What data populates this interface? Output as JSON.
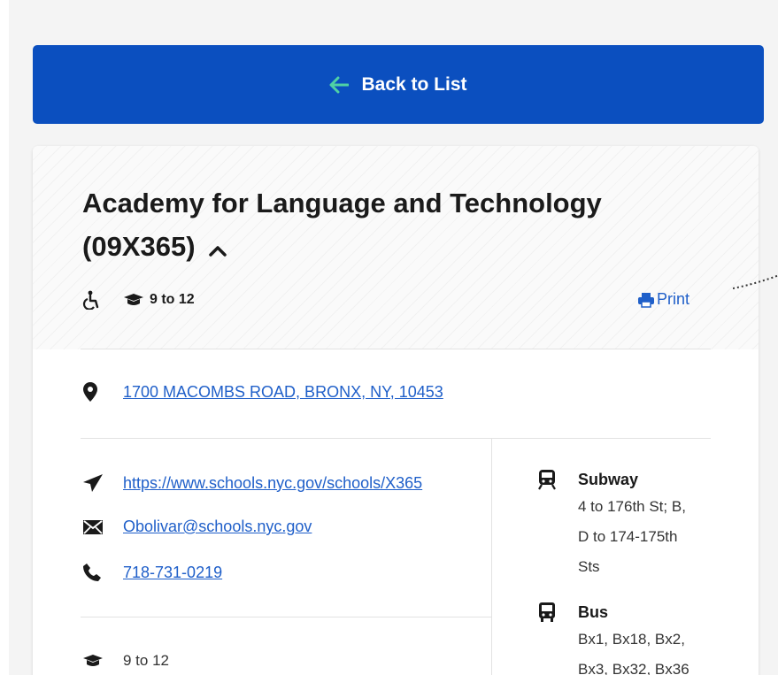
{
  "nav": {
    "back_label": "Back to List",
    "accent_color": "#0b4fbf",
    "arrow_color": "#4fd1a5"
  },
  "school": {
    "name": "Academy for Language and Technology",
    "code": "(09X365)",
    "grades_badge": "9 to 12",
    "print_label": "Print",
    "address": "1700 MACOMBS ROAD, BRONX, NY, 10453",
    "website": "https://www.schools.nyc.gov/schools/X365",
    "email": "Obolivar@schools.nyc.gov",
    "phone": "718-731-0219",
    "grades": "9 to 12"
  },
  "transit": {
    "subway_label": "Subway",
    "subway_lines": [
      "4 to 176th St; B,",
      "D to 174-175th",
      "Sts"
    ],
    "bus_label": "Bus",
    "bus_lines": [
      "Bx1, Bx18, Bx2,",
      "Bx3, Bx32, Bx36"
    ]
  },
  "icons": {
    "accessibility": "wheelchair-icon",
    "grades": "graduation-cap-icon",
    "print": "printer-icon",
    "address": "map-pin-icon",
    "website": "paper-plane-icon",
    "email": "envelope-icon",
    "phone": "phone-icon",
    "subway": "train-icon",
    "bus": "bus-icon"
  }
}
